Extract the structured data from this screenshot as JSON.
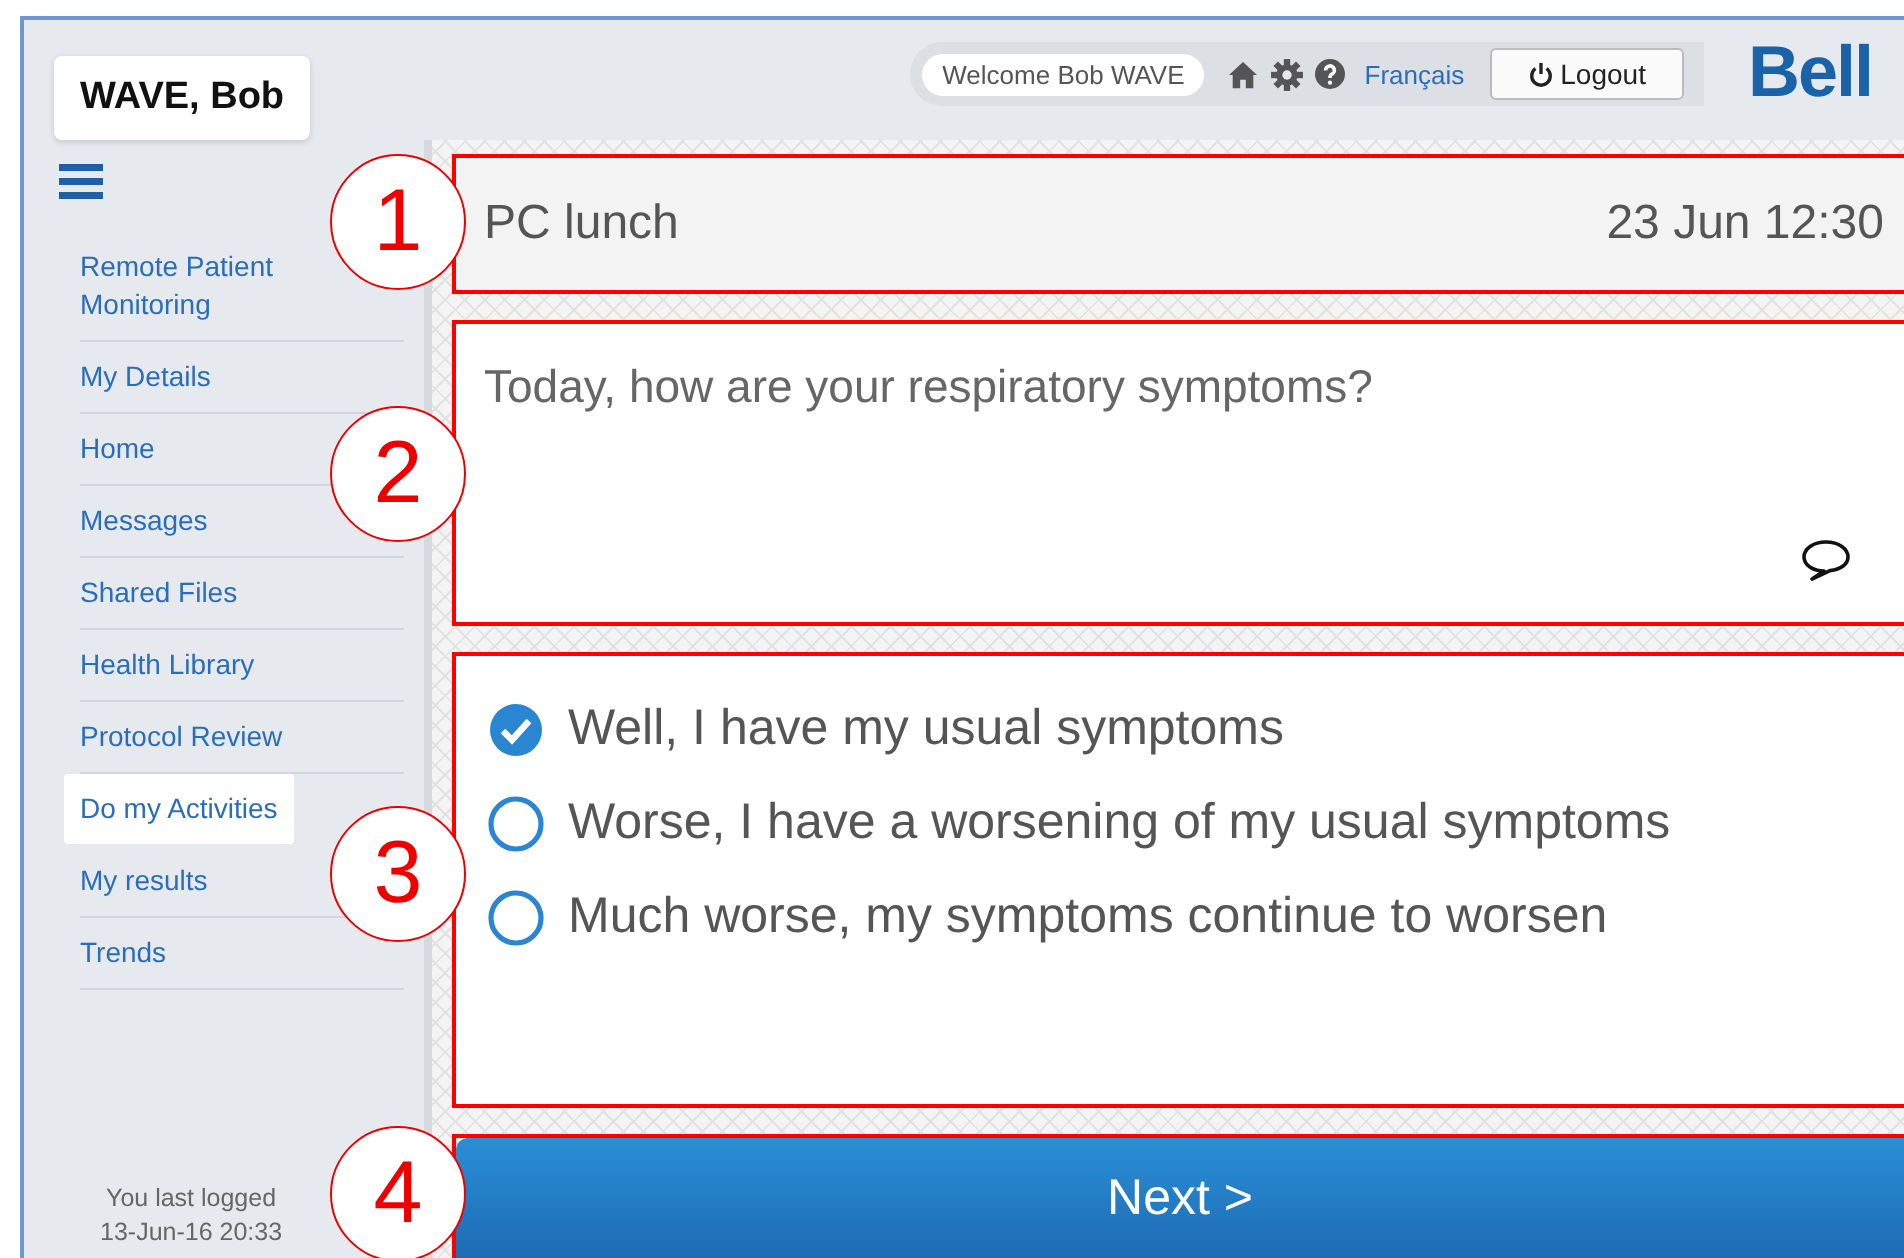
{
  "user_tab": "WAVE, Bob",
  "header": {
    "welcome": "Welcome Bob WAVE",
    "language_link": "Français",
    "logout": "Logout",
    "logo": "Bell"
  },
  "sidebar": {
    "items": [
      {
        "label": "Remote Patient Monitoring",
        "selected": false
      },
      {
        "label": "My Details",
        "selected": false
      },
      {
        "label": "Home",
        "selected": false
      },
      {
        "label": "Messages",
        "selected": false
      },
      {
        "label": "Shared Files",
        "selected": false
      },
      {
        "label": "Health Library",
        "selected": false
      },
      {
        "label": "Protocol Review",
        "selected": false
      },
      {
        "label": "Do my Activities",
        "selected": true
      },
      {
        "label": "My results",
        "selected": false
      },
      {
        "label": "Trends",
        "selected": false
      }
    ],
    "last_login": [
      "You last logged",
      "13-Jun-16 20:33"
    ]
  },
  "activity": {
    "title": "PC lunch",
    "time": "23 Jun 12:30"
  },
  "question": "Today, how are your respiratory symptoms?",
  "options": [
    {
      "label": "Well, I have my usual symptoms",
      "selected": true
    },
    {
      "label": "Worse, I have a worsening of my usual symptoms",
      "selected": false
    },
    {
      "label": "Much worse, my symptoms continue to worsen",
      "selected": false
    }
  ],
  "next_button": "Next >",
  "callouts": [
    "1",
    "2",
    "3",
    "4"
  ]
}
